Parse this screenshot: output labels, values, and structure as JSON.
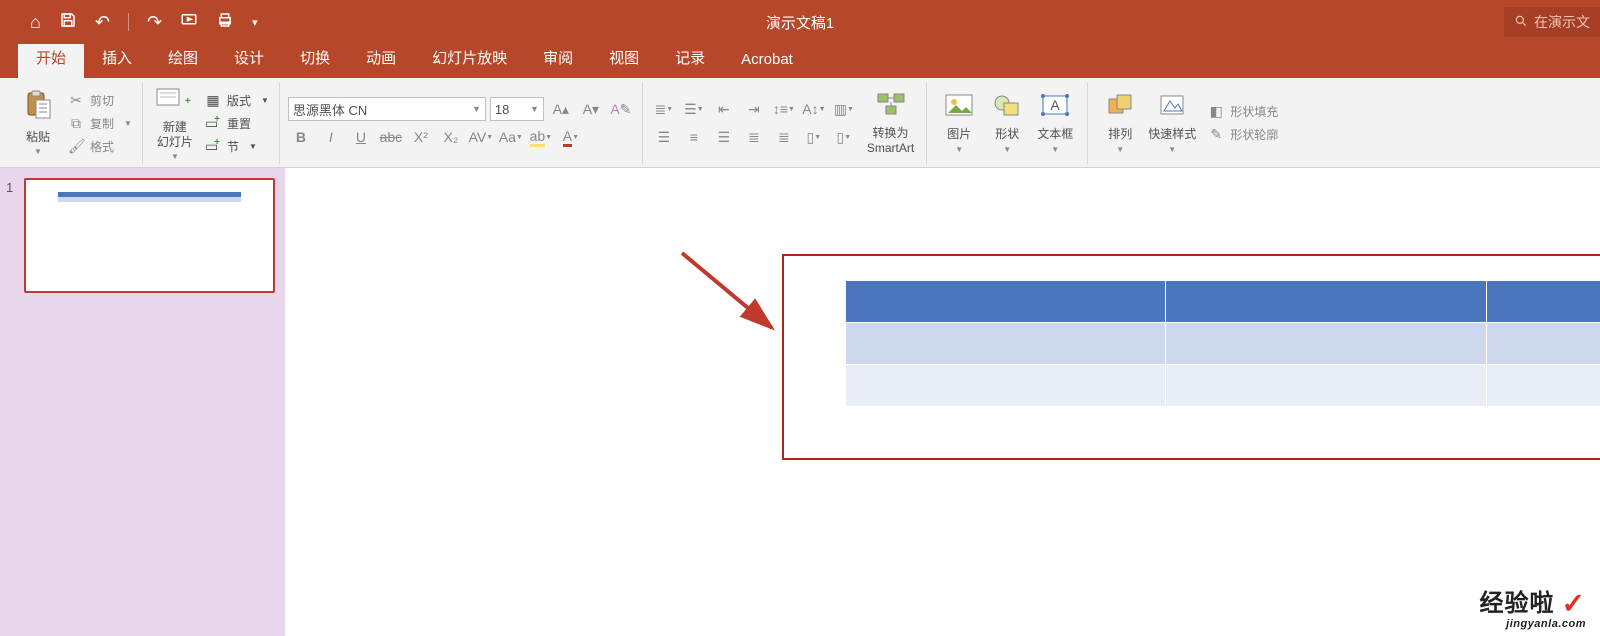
{
  "title": "演示文稿1",
  "search_placeholder": "在演示文",
  "qat": {
    "home": "⌂",
    "save": "💾",
    "undo": "↶",
    "redo": "↷",
    "start_slideshow": "▶",
    "print": "🖨",
    "more": "▾"
  },
  "tabs": [
    "开始",
    "插入",
    "绘图",
    "设计",
    "切换",
    "动画",
    "幻灯片放映",
    "审阅",
    "视图",
    "记录",
    "Acrobat"
  ],
  "active_tab_index": 0,
  "ribbon": {
    "paste": "粘贴",
    "cut": "剪切",
    "copy": "复制",
    "format_painter": "格式",
    "new_slide": "新建\n幻灯片",
    "layout": "版式",
    "reset": "重置",
    "section": "节",
    "font_name": "思源黑体 CN",
    "font_size": "18",
    "convert_smartart": "转换为\nSmartArt",
    "picture": "图片",
    "shapes": "形状",
    "textbox": "文本框",
    "arrange": "排列",
    "quick_styles": "快速样式",
    "shape_fill": "形状填充",
    "shape_outline": "形状轮廓"
  },
  "thumbnail": {
    "number": "1"
  },
  "watermark": {
    "line1": "经验啦",
    "line2": "jingyanla.com"
  }
}
